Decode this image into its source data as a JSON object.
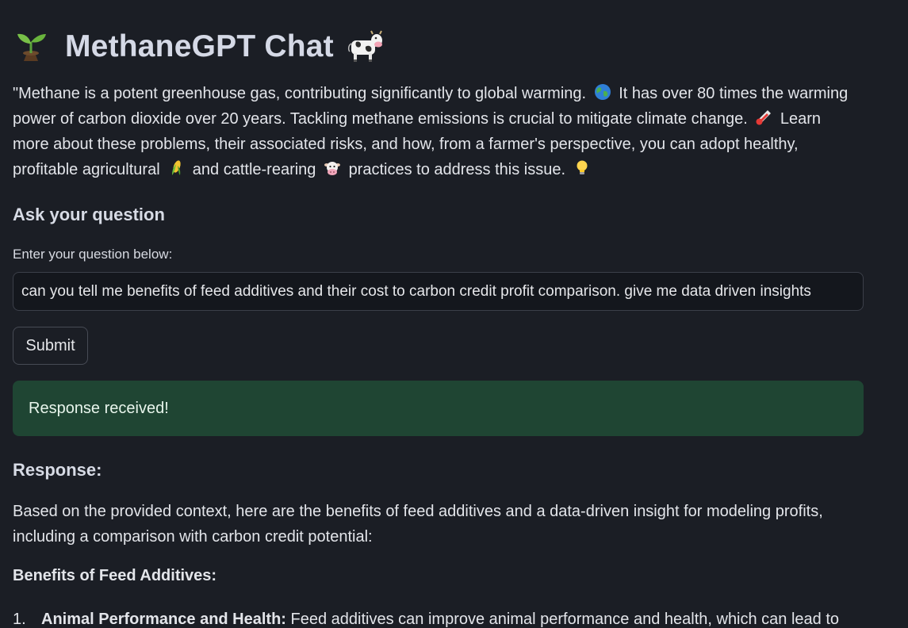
{
  "header": {
    "title": "MethaneGPT Chat",
    "leading_icon": "seedling-icon",
    "trailing_icon": "cow-icon"
  },
  "intro": {
    "part1": "\"Methane is a potent greenhouse gas, contributing significantly to global warming.",
    "part2": "It has over 80 times the warming power of carbon dioxide over 20 years. Tackling methane emissions is crucial to mitigate climate change.",
    "part3": "Learn more about these problems, their associated risks, and how, from a farmer's perspective, you can adopt healthy, profitable agricultural",
    "part4": "and cattle-rearing",
    "part5": "practices to address this issue.",
    "icons": [
      "globe-icon",
      "thermometer-icon",
      "corn-icon",
      "cow-face-icon",
      "lightbulb-icon"
    ]
  },
  "ask": {
    "heading": "Ask your question",
    "label": "Enter your question below:",
    "value": "can you tell me benefits of feed additives and their cost to carbon credit profit comparison. give me data driven insights",
    "submit_label": "Submit"
  },
  "status": {
    "message": "Response received!",
    "color": "#1f4533"
  },
  "response": {
    "heading": "Response:",
    "intro": "Based on the provided context, here are the benefits of feed additives and a data-driven insight for modeling profits, including a comparison with carbon credit potential:",
    "benefits_heading": "Benefits of Feed Additives:",
    "items": [
      {
        "number": "1.",
        "term": "Animal Performance and Health:",
        "text": "Feed additives can improve animal performance and health, which can lead to"
      }
    ]
  }
}
